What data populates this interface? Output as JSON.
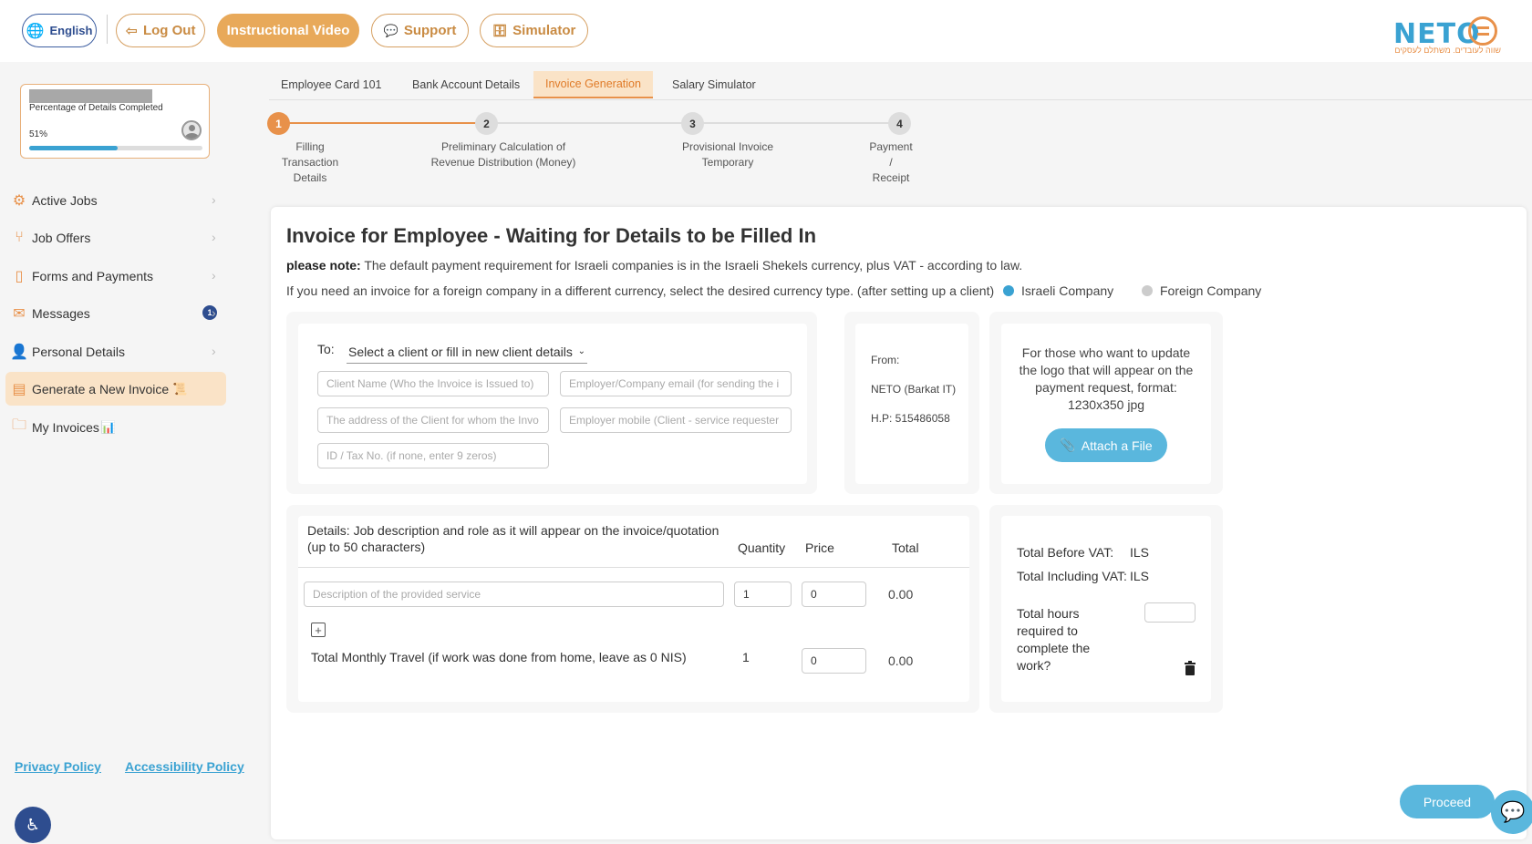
{
  "topbar": {
    "language_label": "English",
    "logout_label": "Log Out",
    "instructional_video_label": "Instructional Video",
    "support_label": "Support",
    "simulator_label": "Simulator",
    "logo_text": "NETO",
    "logo_tagline": "שווה לעובדים. משתלם לעסקים"
  },
  "progress": {
    "label": "Percentage of Details Completed",
    "value_text": "51%",
    "fraction": 0.51
  },
  "sidebar": {
    "items": [
      {
        "label": "Active Jobs",
        "icon": "gear-icon"
      },
      {
        "label": "Job Offers",
        "icon": "chair-icon"
      },
      {
        "label": "Forms and Payments",
        "icon": "document-icon"
      },
      {
        "label": "Messages",
        "icon": "envelope-icon",
        "badge": "1"
      },
      {
        "label": "Personal Details",
        "icon": "user-icon"
      },
      {
        "label": "Generate a New Invoice",
        "icon": "invoice-icon",
        "emoji": "📜"
      },
      {
        "label": "My Invoices",
        "icon": "folder-icon",
        "emoji": "📊"
      }
    ],
    "privacy_policy": "Privacy Policy",
    "accessibility_policy": "Accessibility Policy"
  },
  "tabs": [
    {
      "label": "Employee Card 101"
    },
    {
      "label": "Bank Account Details"
    },
    {
      "label": "Invoice Generation"
    },
    {
      "label": "Salary Simulator"
    }
  ],
  "steps": [
    {
      "number": "1",
      "line1": "Filling",
      "line2": "Transaction",
      "line3": "Details"
    },
    {
      "number": "2",
      "line1": "Preliminary Calculation of",
      "line2": "Revenue Distribution (Money)"
    },
    {
      "number": "3",
      "line1": "Provisional Invoice",
      "line2": "Temporary"
    },
    {
      "number": "4",
      "line1": "Payment",
      "line2": "/",
      "line3": "Receipt"
    }
  ],
  "main": {
    "heading": "Invoice for Employee - Waiting for Details to be Filled In",
    "note_bold": "please note:",
    "note_text": "The default payment requirement for Israeli companies is in the Israeli Shekels currency, plus VAT - according to law.",
    "currency_text": "If you need an invoice for a foreign company in a different currency, select the desired currency type. (after setting up a client)",
    "radio_israeli": "Israeli Company",
    "radio_foreign": "Foreign Company"
  },
  "client": {
    "to_label": "To:",
    "select_placeholder": "Select a client or fill in new client details",
    "client_name_placeholder": "Client Name (Who the Invoice is Issued to)",
    "employer_email_placeholder": "Employer/Company email (for sending the i",
    "address_placeholder": "The address of the Client for whom the Invo",
    "mobile_placeholder": "Employer mobile (Client - service requester",
    "id_placeholder": "ID / Tax No. (if none, enter 9 zeros)"
  },
  "from": {
    "label": "From:",
    "company": "NETO (Barkat IT)",
    "hp": "H.P: 515486058"
  },
  "logo_upload": {
    "text": "For those who want to update the logo that will appear on the payment request, format: 1230x350 jpg",
    "button_label": "Attach a File"
  },
  "details": {
    "header_desc": "Details: Job description and role as it will appear on the invoice/quotation (up to 50 characters)",
    "header_quantity": "Quantity",
    "header_price": "Price",
    "header_total": "Total",
    "row1": {
      "placeholder": "Description of the provided service",
      "quantity": "1",
      "price": "0",
      "total": "0.00"
    },
    "travel": {
      "label": "Total Monthly Travel (if work was done from home, leave as 0 NIS)",
      "quantity": "1",
      "price": "0",
      "total": "0.00"
    }
  },
  "totals": {
    "before_vat": "Total Before VAT:",
    "before_vat_currency": "ILS",
    "including_vat": "Total Including VAT:",
    "including_vat_currency": "ILS",
    "hours_label": "Total hours required to complete the work?"
  },
  "proceed_label": "Proceed"
}
